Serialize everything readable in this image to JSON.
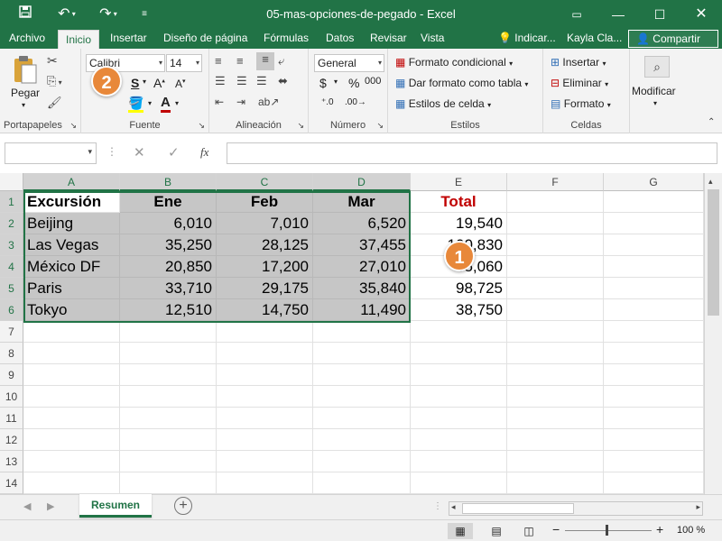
{
  "window": {
    "title": "05-mas-opciones-de-pegado  -  Excel"
  },
  "colors": {
    "accent": "#217346",
    "badge": "#e8883a",
    "total": "#c00000"
  },
  "tabs": [
    "Archivo",
    "Inicio",
    "Insertar",
    "Diseño de página",
    "Fórmulas",
    "Datos",
    "Revisar",
    "Vista"
  ],
  "tell_me": "Indicar...",
  "user": "Kayla Cla...",
  "share": "Compartir",
  "ribbon": {
    "clipboard": {
      "paste": "Pegar",
      "label": "Portapapeles"
    },
    "font": {
      "name": "Calibri",
      "size": "14",
      "label": "Fuente"
    },
    "alignment": {
      "label": "Alineación"
    },
    "number": {
      "format": "General",
      "currency": "$",
      "percent": "%",
      "thousands": "000",
      "label": "Número"
    },
    "styles": {
      "conditional": "Formato condicional",
      "table": "Dar formato como tabla",
      "cell": "Estilos de celda",
      "label": "Estilos"
    },
    "cells": {
      "insert": "Insertar",
      "delete": "Eliminar",
      "format": "Formato",
      "label": "Celdas"
    },
    "editing": {
      "modify": "Modificar"
    }
  },
  "formula": {
    "fx": "fx",
    "value": ""
  },
  "columns": [
    "A",
    "B",
    "C",
    "D",
    "E",
    "F",
    "G"
  ],
  "rows": [
    "1",
    "2",
    "3",
    "4",
    "5",
    "6",
    "7",
    "8",
    "9",
    "10",
    "11",
    "12",
    "13",
    "14"
  ],
  "table": {
    "headers": [
      "Excursión",
      "Ene",
      "Feb",
      "Mar",
      "Total"
    ],
    "data": [
      [
        "Beijing",
        "6,010",
        "7,010",
        "6,520",
        "19,540"
      ],
      [
        "Las Vegas",
        "35,250",
        "28,125",
        "37,455",
        "100,830"
      ],
      [
        "México DF",
        "20,850",
        "17,200",
        "27,010",
        "65,060"
      ],
      [
        "Paris",
        "33,710",
        "29,175",
        "35,840",
        "98,725"
      ],
      [
        "Tokyo",
        "12,510",
        "14,750",
        "11,490",
        "38,750"
      ]
    ]
  },
  "callouts": {
    "one": "1",
    "two": "2"
  },
  "sheet": {
    "name": "Resumen"
  },
  "status": {
    "zoom": "100 %"
  }
}
